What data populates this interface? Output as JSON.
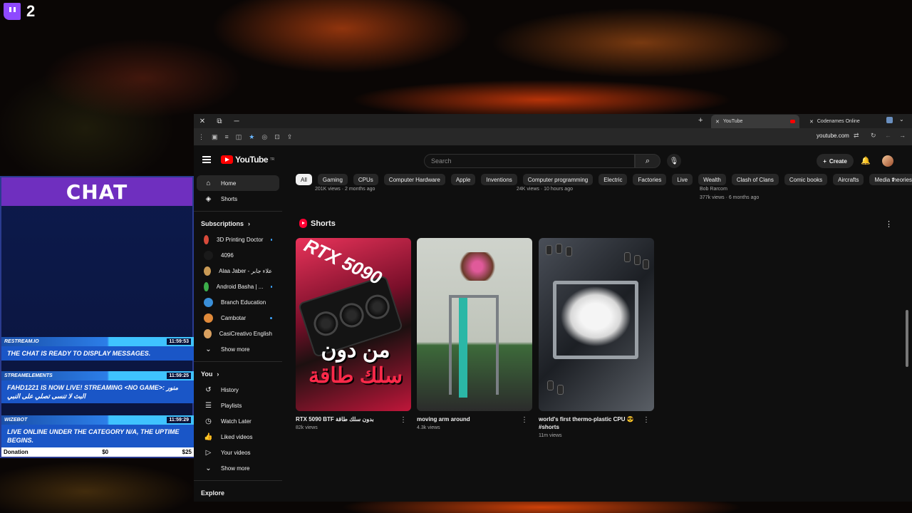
{
  "overlay": {
    "viewer_count": "2",
    "chat_title": "CHAT",
    "messages": [
      {
        "source": "RESTREAM.IO",
        "time": "11:59:53",
        "text": "THE CHAT IS READY TO DISPLAY MESSAGES."
      },
      {
        "source": "STREAMELEMENTS",
        "time": "11:59:25",
        "text": "FAHD1221 IS NOW LIVE! STREAMING <NO GAME>: منور البث لا تنسى تصلي على النبي"
      },
      {
        "source": "WIZEBOT",
        "time": "11:59:29",
        "text": "LIVE ONLINE UNDER THE CATEGORY N/A, THE UPTIME BEGINS."
      }
    ],
    "donation_label": "Donation",
    "donation_current": "$0",
    "donation_goal": "$25"
  },
  "browser": {
    "tabs": [
      {
        "label": "YouTube",
        "active": true
      },
      {
        "label": "Codenames Online",
        "active": false
      }
    ],
    "url": "youtube.com"
  },
  "youtube": {
    "logo_text": "YouTube",
    "logo_region": "TR",
    "search_placeholder": "Search",
    "create_label": "Create",
    "sidebar": {
      "main": [
        {
          "label": "Home",
          "icon": "home-icon"
        },
        {
          "label": "Shorts",
          "icon": "shorts-icon"
        }
      ],
      "subscriptions_label": "Subscriptions",
      "subscriptions": [
        {
          "label": "3D Printing Doctor",
          "color": "#d84a3a",
          "dot": true
        },
        {
          "label": "4096",
          "color": "#1a1a1a",
          "dot": false
        },
        {
          "label": "Alaa Jaber - علاء جابر",
          "color": "#c99a55",
          "dot": false
        },
        {
          "label": "Android Basha | ...",
          "color": "#3cae4a",
          "dot": true
        },
        {
          "label": "Branch Education",
          "color": "#3a8fd8",
          "dot": false
        },
        {
          "label": "Cambotar",
          "color": "#e08a3a",
          "dot": true
        },
        {
          "label": "CasiCreativo English",
          "color": "#d8a060",
          "dot": false
        }
      ],
      "show_more": "Show more",
      "you_label": "You",
      "you_items": [
        {
          "label": "History",
          "icon": "history-icon"
        },
        {
          "label": "Playlists",
          "icon": "playlists-icon"
        },
        {
          "label": "Watch Later",
          "icon": "clock-icon"
        },
        {
          "label": "Liked videos",
          "icon": "thumbs-up-icon"
        },
        {
          "label": "Your videos",
          "icon": "video-icon"
        }
      ],
      "show_more_2": "Show more",
      "explore_label": "Explore"
    },
    "chips": [
      "All",
      "Gaming",
      "CPUs",
      "Computer Hardware",
      "Apple",
      "Inventions",
      "Computer programming",
      "Electric",
      "Factories",
      "Live",
      "Wealth",
      "Clash of Clans",
      "Comic books",
      "Aircrafts",
      "Media theories"
    ],
    "previous_row": [
      {
        "text": "201K views · 2 months ago"
      },
      {
        "text": "24K views · 10 hours ago"
      },
      {
        "channel": "Bob Rarcom",
        "text": "377k views · 6 months ago"
      }
    ],
    "shorts_title": "Shorts",
    "shorts": [
      {
        "title": "RTX 5090 BTF بدون سلك طاقة",
        "views": "82k views",
        "thumb_text": "RTX 5090",
        "thumb_ar_1": "من دون",
        "thumb_ar_2": "سلك طاقة"
      },
      {
        "title": "moving arm around",
        "views": "4.3k views"
      },
      {
        "title": "world's first thermo-plastic CPU 😎 #shorts",
        "views": "11m views"
      }
    ]
  }
}
